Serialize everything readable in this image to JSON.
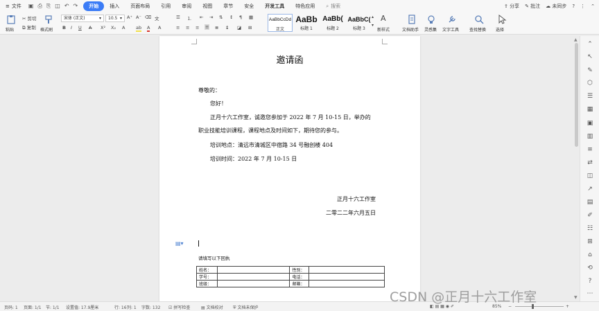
{
  "menubar": {
    "file_label": "文件",
    "tabs": [
      "开始",
      "插入",
      "页面布局",
      "引用",
      "审阅",
      "视图",
      "章节",
      "安全",
      "开发工具",
      "特色应用"
    ],
    "active_tab": "开始",
    "search_label": "搜索",
    "share_label": "分享",
    "comment_label": "批注",
    "sync_label": "未同步"
  },
  "ribbon": {
    "paste": "粘贴",
    "cut": "剪切",
    "copy": "复制",
    "format_painter": "格式刷",
    "font_name": "宋体 (正文)",
    "font_size": "10.5",
    "styles": [
      {
        "sample": "AaBbCcDd",
        "name": "正文"
      },
      {
        "sample": "AaBb",
        "name": "标题 1"
      },
      {
        "sample": "AaBb(",
        "name": "标题 2"
      },
      {
        "sample": "AaBbC(",
        "name": "标题 3"
      }
    ],
    "new_style": "新样式",
    "doc_helper": "文档助手",
    "text_inspire": "灵感集",
    "text_tools": "文字工具",
    "find_replace": "查找替换",
    "select": "选择"
  },
  "document": {
    "title": "邀请函",
    "salutation": "尊敬的：",
    "greeting": "您好！",
    "body1": "正月十六工作室，诚邀您参加于 2022 年 7 月 10-15 日，举办的",
    "body2": "职业技能培训课程，课程地点及时间如下，期待您的参与。",
    "location": "培训地点：清远市清城区中宿路 34 号融创楼 404",
    "time": "培训时间：2022 年 7 月 10-15 日",
    "signature": "正月十六工作室",
    "date": "二零二二年六月五日",
    "form_hint": "请填写以下回执",
    "form": [
      [
        "姓名：",
        "",
        "性别：",
        ""
      ],
      [
        "学号：",
        "",
        "电话：",
        ""
      ],
      [
        "班级：",
        "",
        "邮箱：",
        ""
      ]
    ]
  },
  "status": {
    "page_count": "页码: 1",
    "pages": "页面: 1/1",
    "section": "节: 1/1",
    "position": "设置值: 17.9厘米",
    "row": "行: 16",
    "col": "列: 1",
    "words": "字数: 132",
    "spell": "拼写检查",
    "doc_check": "文档校对",
    "protect": "文档未保护",
    "zoom": "85%"
  },
  "watermark": "CSDN @正月十六工作室"
}
